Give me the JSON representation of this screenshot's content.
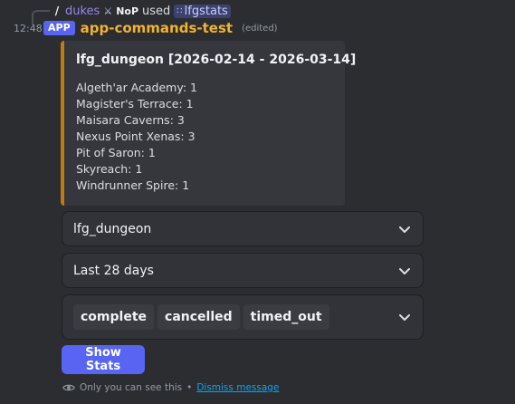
{
  "reply": {
    "username": "dukes",
    "guild_tag": "NoP",
    "used_text": "used",
    "command": "lfgstats"
  },
  "message": {
    "timestamp": "12:48",
    "badge": "APP",
    "bot_name": "app-commands-test",
    "edited": "(edited)"
  },
  "embed": {
    "accent_color": "#c27c0e",
    "title": "lfg_dungeon [2026-02-14 - 2026-03-14]",
    "lines": [
      "Algeth'ar Academy: 1",
      "Magister's Terrace: 1",
      "Maisara Caverns: 3",
      "Nexus Point Xenas: 3",
      "Pit of Saron: 1",
      "Skyreach: 1",
      "Windrunner Spire: 1"
    ]
  },
  "selects": {
    "category": "lfg_dungeon",
    "period": "Last 28 days",
    "statuses": [
      "complete",
      "cancelled",
      "timed_out"
    ]
  },
  "button": {
    "label": "Show Stats"
  },
  "footer": {
    "note": "Only you can see this",
    "separator": "•",
    "dismiss": "Dismiss message"
  },
  "icons": {
    "slash": "slash-command-icon",
    "guild": "guild-tag-icon",
    "command": "app-command-icon",
    "chevron": "chevron-down-icon",
    "eye": "eye-icon"
  }
}
